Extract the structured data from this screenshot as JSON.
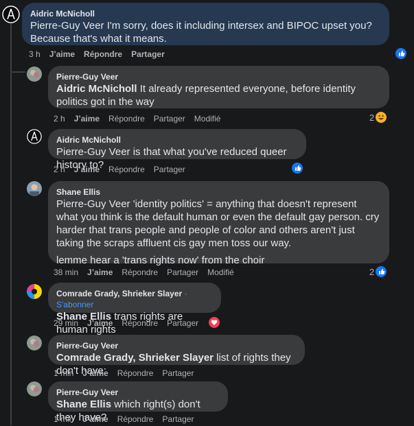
{
  "comments": [
    {
      "author": "Aidric McNicholl",
      "mention": "",
      "text": "Pierre-Guy Veer I'm sorry, does it including intersex and BIPOC upset you? Because that's what it means.",
      "time": "3 h",
      "actions": [
        "J’aime",
        "Répondre",
        "Partager"
      ],
      "reaction_count": "",
      "edited": ""
    },
    {
      "author": "Pierre-Guy Veer",
      "mention": "Aidric McNicholl",
      "text": " It already represented everyone, before identity politics got in the way",
      "time": "2 h",
      "actions": [
        "J’aime",
        "Répondre",
        "Partager"
      ],
      "reaction_count": "2",
      "edited": "Modifié"
    },
    {
      "author": "Aidric McNicholl",
      "mention": "",
      "text": "Pierre-Guy Veer is that what you've reduced queer history to?",
      "time": "2 h",
      "actions": [
        "J’aime",
        "Répondre",
        "Partager"
      ],
      "reaction_count": "",
      "edited": ""
    },
    {
      "author": "Shane Ellis",
      "mention": "",
      "text": "Pierre-Guy Veer 'identity politics' = anything that doesn't represent what you think is the default human or even the default gay person. cry harder that trans people and people of color and others aren't just taking the scraps affluent cis gay men toss our way.",
      "text2": "lemme hear a 'trans rights now' from the choir",
      "time": "38 min",
      "actions": [
        "J’aime",
        "Répondre",
        "Partager"
      ],
      "reaction_count": "2",
      "edited": "Modifié"
    },
    {
      "author": "Comrade Grady, Shrieker Slayer",
      "subscribe": "S'abonner",
      "mention": "Shane Ellis",
      "text": " trans rights are human rights",
      "time": "29 min",
      "actions": [
        "J’aime",
        "Répondre",
        "Partager"
      ],
      "reaction_count": "",
      "edited": ""
    },
    {
      "author": "Pierre-Guy Veer",
      "mention": "Comrade Grady, Shrieker Slayer",
      "text": " list of rights they don't have:",
      "time": "1 min",
      "actions": [
        "J’aime",
        "Répondre",
        "Partager"
      ],
      "reaction_count": "",
      "edited": ""
    },
    {
      "author": "Pierre-Guy Veer",
      "mention": "Shane Ellis",
      "text": " which right(s) don't they have?",
      "time": "1 min",
      "actions": [
        "J’aime",
        "Répondre",
        "Partager"
      ],
      "reaction_count": "",
      "edited": ""
    }
  ],
  "subscribe_sep": "·",
  "colors": {
    "like_blue": "#1877f2",
    "love_red": "#f33e58",
    "haha_yellow": "#f7b125",
    "link_blue": "#4599ff"
  },
  "icons": {
    "like": "like-icon",
    "love": "love-icon",
    "haha": "haha-icon"
  }
}
